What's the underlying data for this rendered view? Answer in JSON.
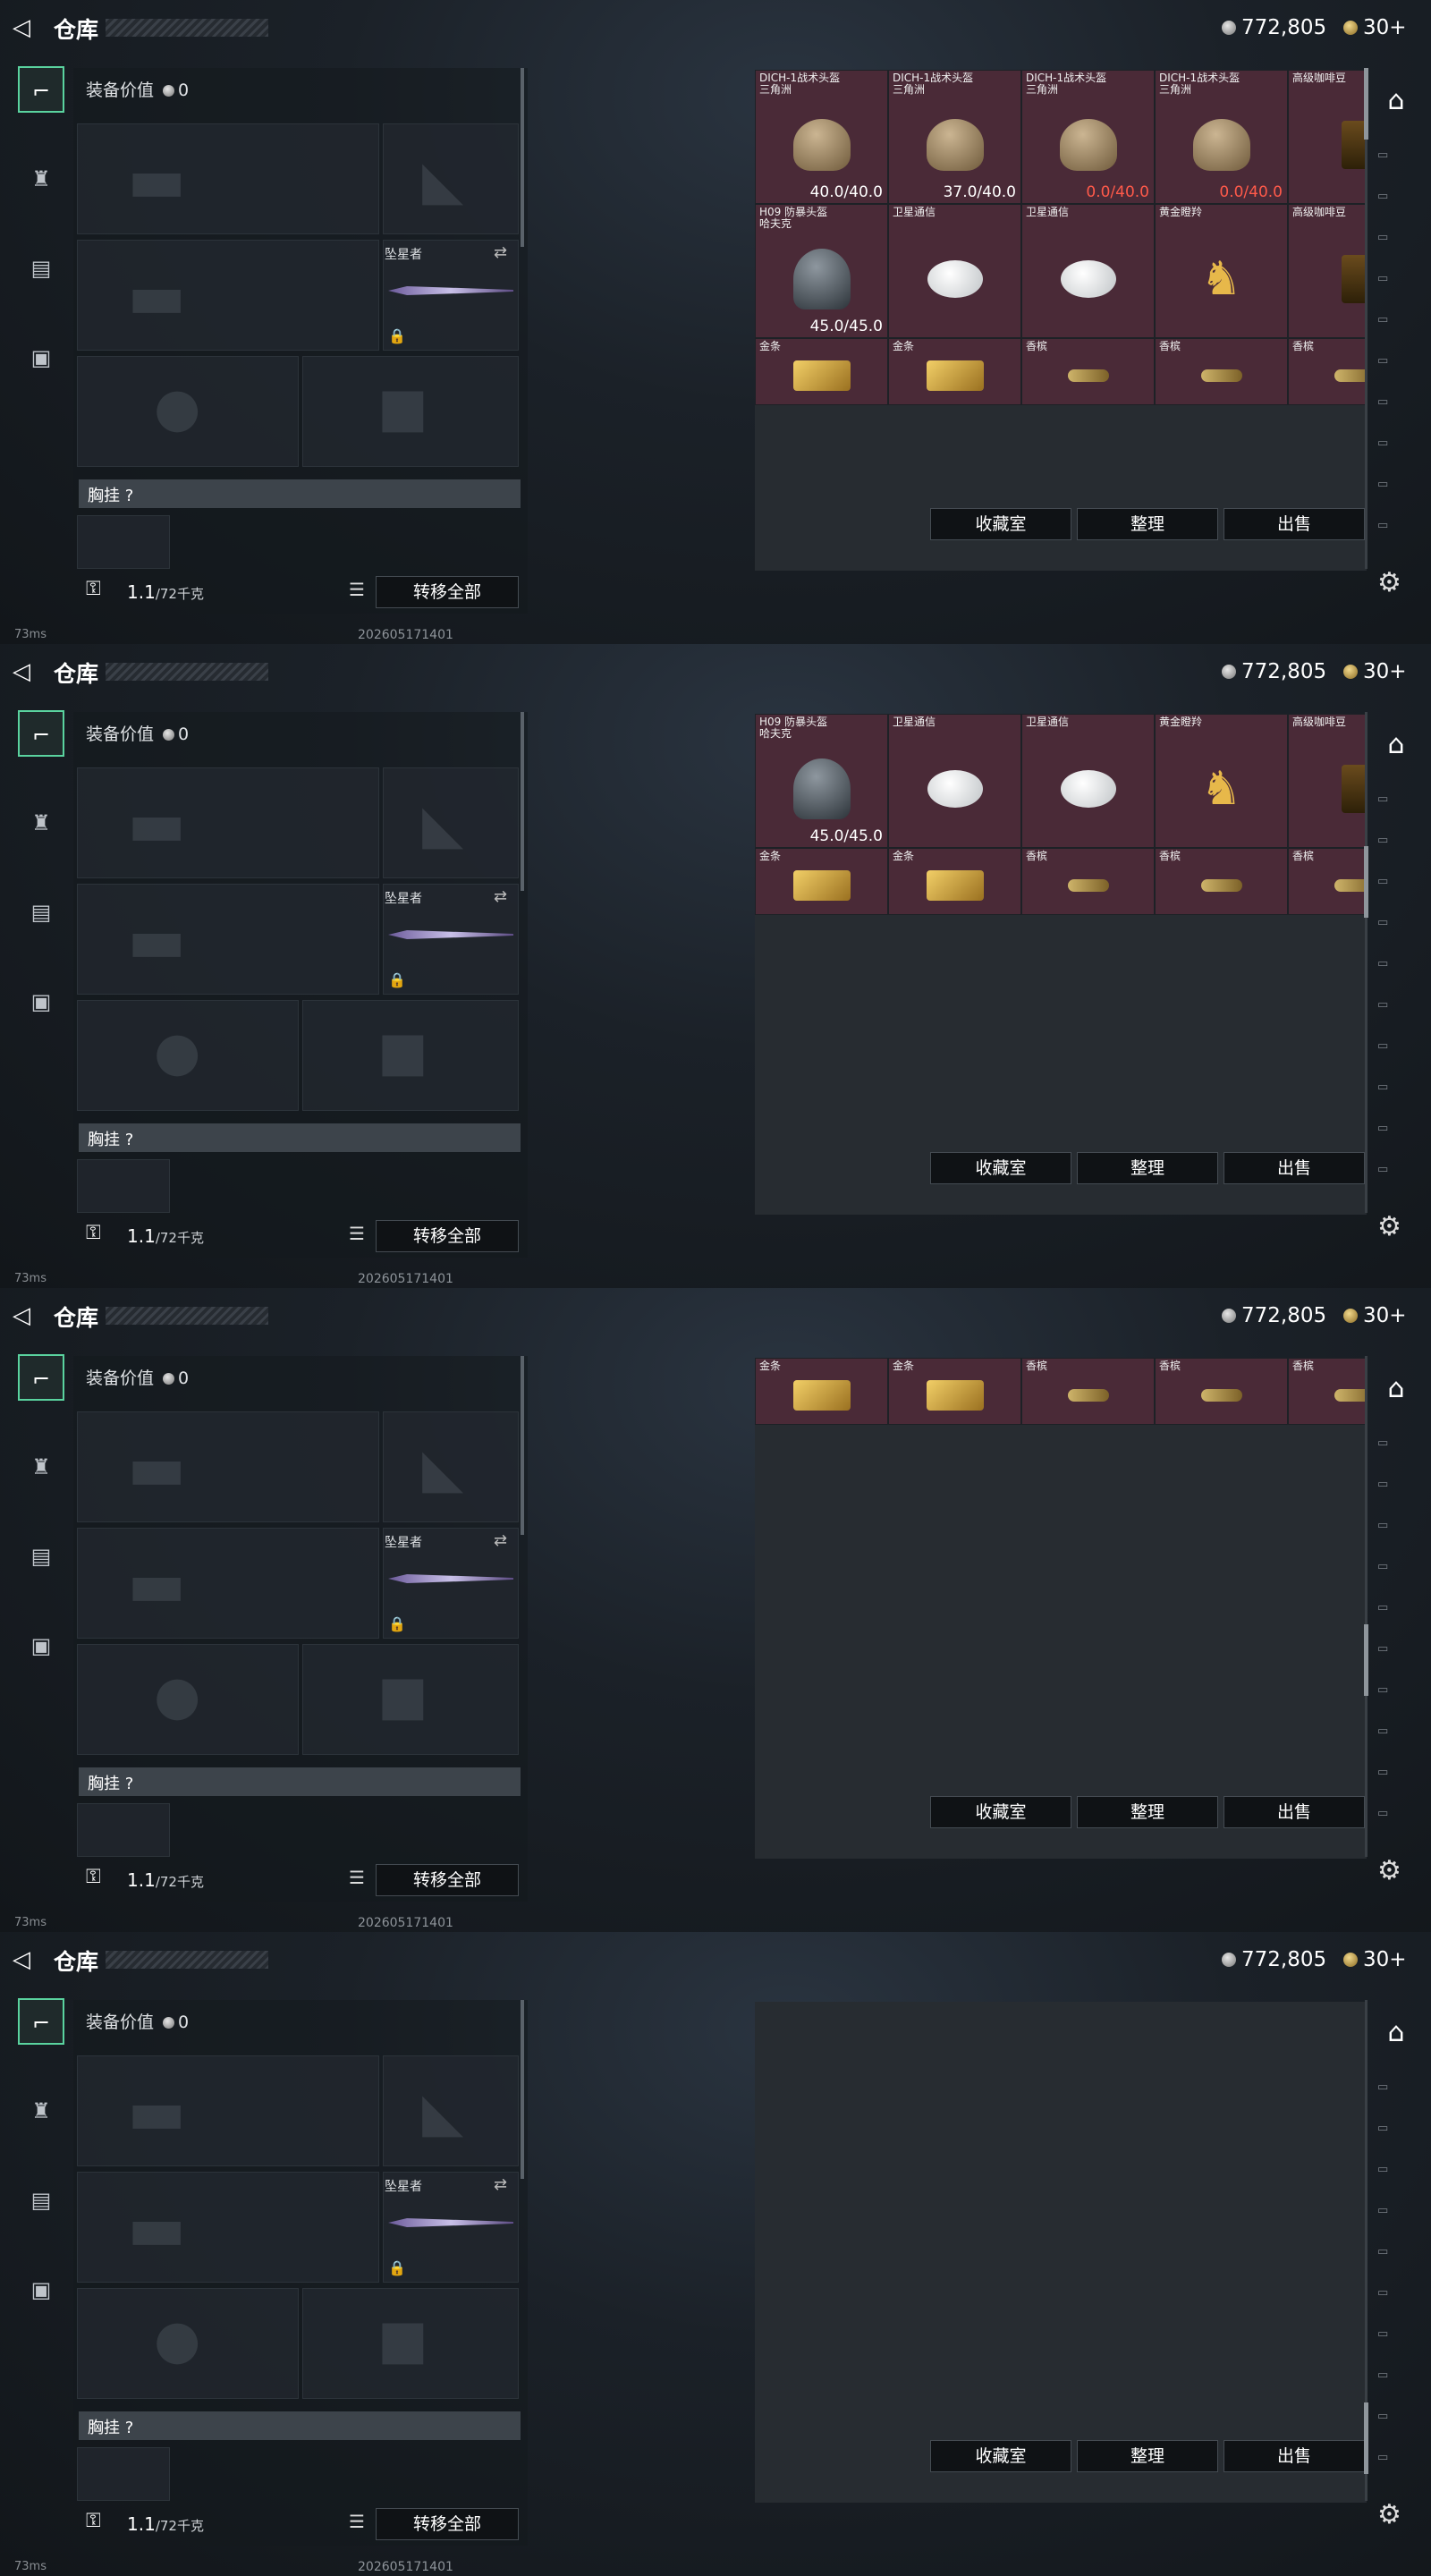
{
  "header": {
    "title": "仓库",
    "silver": "772,805",
    "gold": "30+"
  },
  "loadout": {
    "equip_value_label": "装备价值",
    "equip_value": "0",
    "melee_name": "坠星者",
    "chest_label": "胸挂 ?",
    "weight": "1.1",
    "weight_cap": "/72千克",
    "move_all": "转移全部"
  },
  "status": {
    "ping": "73ms",
    "stamp": "202605171401"
  },
  "stash_buttons": {
    "collection": "收藏室",
    "sort": "整理",
    "sell": "出售"
  },
  "stash_items": [
    {
      "r": 0,
      "c": 0,
      "w": 1,
      "h": 2,
      "n": "DICH-1战术头盔\n三角洲",
      "q": "40.0/40.0",
      "k": "purple",
      "ic": "helm"
    },
    {
      "r": 0,
      "c": 1,
      "w": 1,
      "h": 2,
      "n": "DICH-1战术头盔\n三角洲",
      "q": "37.0/40.0",
      "k": "purple",
      "ic": "helm"
    },
    {
      "r": 0,
      "c": 2,
      "w": 1,
      "h": 2,
      "n": "DICH-1战术头盔\n三角洲",
      "q": "0.0/40.0",
      "qr": true,
      "k": "purple",
      "ic": "helm"
    },
    {
      "r": 0,
      "c": 3,
      "w": 1,
      "h": 2,
      "n": "DICH-1战术头盔\n三角洲",
      "q": "0.0/40.0",
      "qr": true,
      "k": "purple",
      "ic": "helm"
    },
    {
      "r": 0,
      "c": 4,
      "w": 1,
      "h": 2,
      "n": "高级咖啡豆",
      "k": "purple",
      "ic": "coffee"
    },
    {
      "r": 2,
      "c": 0,
      "w": 1,
      "h": 2,
      "n": "H09 防暴头盔\n哈夫克",
      "q": "45.0/45.0",
      "k": "purple",
      "ic": "helm2"
    },
    {
      "r": 2,
      "c": 1,
      "w": 1,
      "h": 2,
      "n": "卫星通信",
      "k": "purple",
      "ic": "dish"
    },
    {
      "r": 2,
      "c": 2,
      "w": 1,
      "h": 2,
      "n": "卫星通信",
      "k": "purple",
      "ic": "dish"
    },
    {
      "r": 2,
      "c": 3,
      "w": 1,
      "h": 2,
      "n": "黄金瞪羚",
      "k": "purple",
      "ic": "deer"
    },
    {
      "r": 2,
      "c": 4,
      "w": 1,
      "h": 2,
      "n": "高级咖啡豆",
      "k": "purple",
      "ic": "coffee"
    },
    {
      "r": 4,
      "c": 0,
      "w": 1,
      "h": 1,
      "n": "金条",
      "k": "purple",
      "ic": "bar"
    },
    {
      "r": 4,
      "c": 1,
      "w": 1,
      "h": 1,
      "n": "金条",
      "k": "purple",
      "ic": "bar"
    },
    {
      "r": 4,
      "c": 2,
      "w": 1,
      "h": 1,
      "n": "香槟",
      "k": "purple",
      "ic": "bottle"
    },
    {
      "r": 4,
      "c": 3,
      "w": 1,
      "h": 1,
      "n": "香槟",
      "k": "purple",
      "ic": "bottle"
    },
    {
      "r": 4,
      "c": 4,
      "w": 1,
      "h": 1,
      "n": "香槟",
      "k": "purple",
      "ic": "bottle"
    }
  ]
}
